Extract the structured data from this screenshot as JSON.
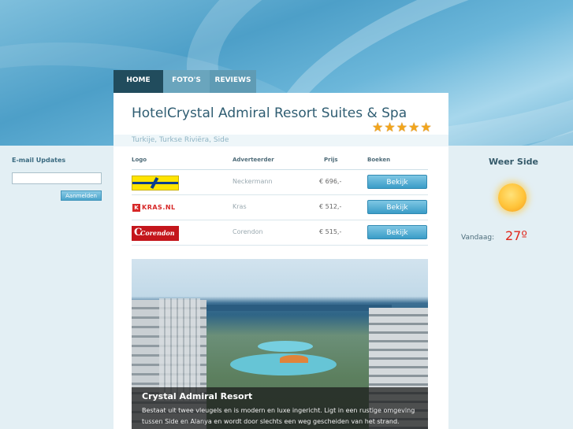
{
  "colors": {
    "accent": "#214c5d",
    "button": "#3a9cc7",
    "star": "#f2a51c",
    "temperature": "#e0281c"
  },
  "nav": {
    "tabs": [
      {
        "label": "HOME"
      },
      {
        "label": "FOTO'S"
      },
      {
        "label": "REVIEWS"
      }
    ],
    "active": "HOME"
  },
  "hotel": {
    "title": "HotelCrystal Admiral Resort Suites & Spa",
    "rating_stars": 5,
    "location": "Turkije, Turkse Riviëra, Side"
  },
  "offers": {
    "headers": {
      "logo": "Logo",
      "advertiser": "Adverteerder",
      "price": "Prijs",
      "book": "Boeken"
    },
    "rows": [
      {
        "logo": "neckermann-logo",
        "advertiser": "Neckermann",
        "price": "€ 696,-",
        "button": "Bekijk"
      },
      {
        "logo": "kras-logo",
        "advertiser": "Kras",
        "price": "€ 512,-",
        "button": "Bekijk",
        "logo_text": "KRAS.NL"
      },
      {
        "logo": "corendon-logo",
        "advertiser": "Corendon",
        "price": "€ 515,-",
        "button": "Bekijk",
        "logo_text": "Corendon"
      }
    ]
  },
  "photo": {
    "caption_title": "Crystal Admiral Resort",
    "caption_text": "Bestaat uit twee vleugels en is modern en luxe ingericht. Ligt in een rustige omgeving tussen Side en Alanya en wordt door slechts een weg gescheiden van het strand."
  },
  "newsletter": {
    "label": "E-mail Updates",
    "input_value": "",
    "button": "Aanmelden"
  },
  "weather": {
    "title": "Weer Side",
    "icon": "sun-icon",
    "label": "Vandaag:",
    "temperature": "27º"
  }
}
